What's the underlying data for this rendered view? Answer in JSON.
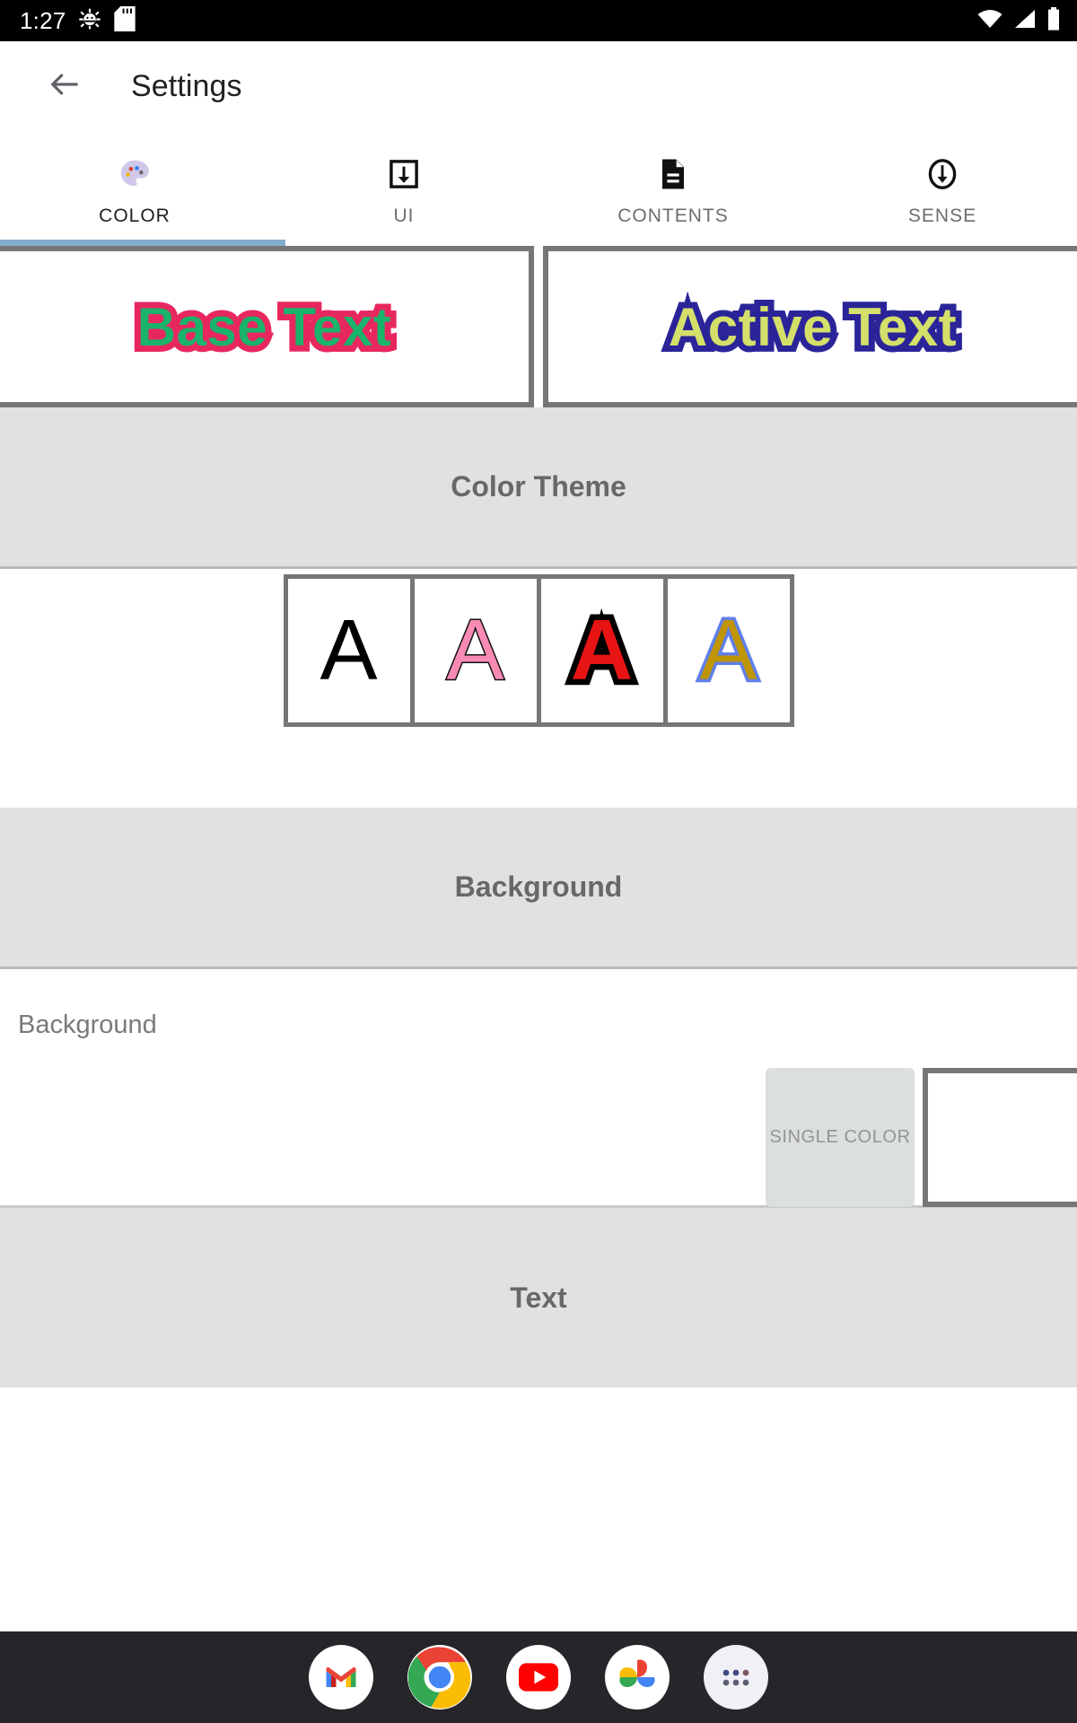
{
  "status_bar": {
    "time": "1:27",
    "left_icons": [
      "bug-gear-icon",
      "sd-card-icon"
    ],
    "right_icons": [
      "wifi-icon",
      "cell-signal-icon",
      "battery-icon"
    ],
    "background_color": "#000000"
  },
  "app_bar": {
    "back_icon": "back-arrow-icon",
    "title": "Settings"
  },
  "tabs": {
    "active_index": 0,
    "indicator_color": "#82aece",
    "items": [
      {
        "label": "COLOR",
        "icon": "palette-icon",
        "active": true
      },
      {
        "label": "UI",
        "icon": "download-box-icon",
        "active": false
      },
      {
        "label": "CONTENTS",
        "icon": "document-icon",
        "active": false
      },
      {
        "label": "SENSE",
        "icon": "circle-down-arrow-icon",
        "active": false
      }
    ]
  },
  "preview": {
    "base": {
      "text": "Base Text",
      "fill_color": "#19b36b",
      "stroke_color": "#e8275f"
    },
    "active": {
      "text": "Active Text",
      "fill_color": "#d4e06a",
      "stroke_color": "#2b2499"
    }
  },
  "sections": {
    "color_theme": {
      "title": "Color Theme",
      "swatches": [
        {
          "glyph": "A",
          "fill_color": "#000000",
          "stroke_color": "none"
        },
        {
          "glyph": "A",
          "fill_color": "#f98ab4",
          "stroke_color": "#111111"
        },
        {
          "glyph": "A",
          "fill_color": "#e81414",
          "stroke_color": "#000000"
        },
        {
          "glyph": "A",
          "fill_color": "#c09504",
          "stroke_color": "#5f7fe8"
        }
      ]
    },
    "background": {
      "title": "Background",
      "row_label": "Background",
      "mode_button": "SINGLE COLOR",
      "swatch_color": "#ffffff"
    },
    "text": {
      "title": "Text"
    }
  },
  "dock": {
    "background_color": "#26262a",
    "apps": [
      {
        "name": "gmail-icon",
        "label": "Gmail"
      },
      {
        "name": "chrome-icon",
        "label": "Chrome"
      },
      {
        "name": "youtube-icon",
        "label": "YouTube"
      },
      {
        "name": "google-photos-icon",
        "label": "Photos"
      },
      {
        "name": "app-drawer-icon",
        "label": "Apps"
      }
    ]
  }
}
